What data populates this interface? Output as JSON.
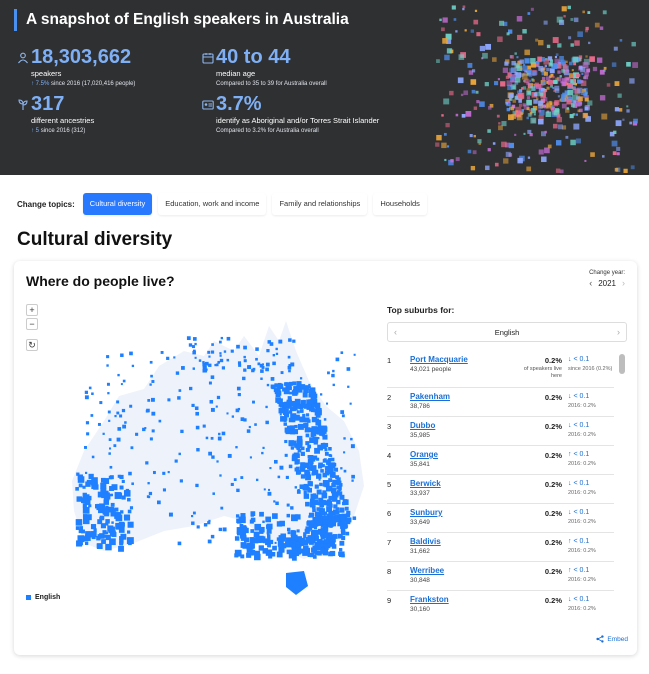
{
  "hero": {
    "title": "A snapshot of English speakers in Australia",
    "stats": [
      {
        "icon": "person-icon",
        "value": "18,303,662",
        "label": "speakers",
        "sub_arrow": "↑",
        "sub_pct": "7.5%",
        "sub_rest": "since 2016 (17,020,416 people)"
      },
      {
        "icon": "calendar-icon",
        "value": "40 to 44",
        "label": "median age",
        "sub_rest": "Compared to 35 to 39 for Australia overall"
      },
      {
        "icon": "heritage-icon",
        "value": "317",
        "label": "different ancestries",
        "sub_arrow": "↑",
        "sub_pct": "5",
        "sub_rest": "since 2016 (312)"
      },
      {
        "icon": "id-card-icon",
        "value": "3.7%",
        "label": "identify as Aboriginal and/or Torres Strait Islander",
        "sub_rest": "Compared to 3.2% for Australia overall"
      }
    ]
  },
  "topics": {
    "label": "Change topics:",
    "items": [
      "Cultural diversity",
      "Education, work and income",
      "Family and relationships",
      "Households"
    ],
    "active_index": 0
  },
  "section_title": "Cultural diversity",
  "card": {
    "title": "Where do people live?",
    "year_label": "Change year:",
    "year": "2021",
    "map_controls": {
      "zoom_in": "+",
      "zoom_out": "−",
      "reset": "↻"
    },
    "legend": "English",
    "colors": {
      "accent": "#1e7fff",
      "link": "#1a6fd6",
      "hero_bg": "#2f3032"
    },
    "top_suburbs_label": "Top suburbs for:",
    "language": "English",
    "suburbs": [
      {
        "rank": "1",
        "name": "Port Macquarie",
        "count": "43,021 people",
        "pct": "0.2%",
        "pct_note": "of speakers live here",
        "change": "↓ < 0.1",
        "change_note": "since 2016 (0.2%)"
      },
      {
        "rank": "2",
        "name": "Pakenham",
        "count": "38,786",
        "pct": "0.2%",
        "change": "↓ < 0.1",
        "change_note": "2016: 0.2%"
      },
      {
        "rank": "3",
        "name": "Dubbo",
        "count": "35,985",
        "pct": "0.2%",
        "change": "↓ < 0.1",
        "change_note": "2016: 0.2%"
      },
      {
        "rank": "4",
        "name": "Orange",
        "count": "35,841",
        "pct": "0.2%",
        "change": "↑ < 0.1",
        "change_note": "2016: 0.2%"
      },
      {
        "rank": "5",
        "name": "Berwick",
        "count": "33,937",
        "pct": "0.2%",
        "change": "↓ < 0.1",
        "change_note": "2016: 0.2%"
      },
      {
        "rank": "6",
        "name": "Sunbury",
        "count": "33,649",
        "pct": "0.2%",
        "change": "↓ < 0.1",
        "change_note": "2016: 0.2%"
      },
      {
        "rank": "7",
        "name": "Baldivis",
        "count": "31,662",
        "pct": "0.2%",
        "change": "↑ < 0.1",
        "change_note": "2016: 0.2%"
      },
      {
        "rank": "8",
        "name": "Werribee",
        "count": "30,848",
        "pct": "0.2%",
        "change": "↑ < 0.1",
        "change_note": "2016: 0.2%"
      },
      {
        "rank": "9",
        "name": "Frankston",
        "count": "30,160",
        "pct": "0.2%",
        "change": "↓ < 0.1",
        "change_note": "2016: 0.2%"
      }
    ],
    "embed_label": "Embed"
  }
}
